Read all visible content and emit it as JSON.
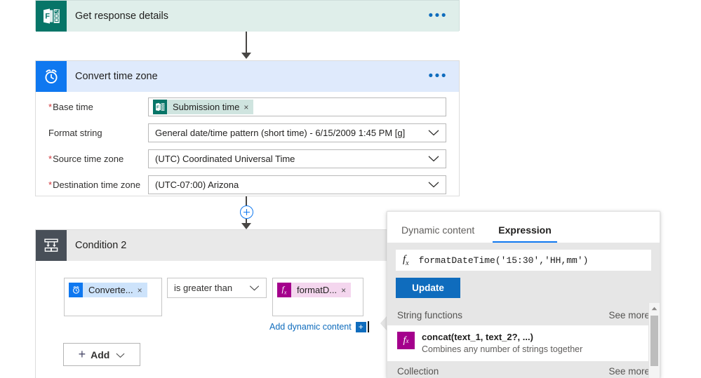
{
  "flow": {
    "forms_action": {
      "title": "Get response details",
      "icon": "microsoft-forms-icon",
      "menu": "•••",
      "header_bg": "#dfeeea",
      "icon_bg": "#077568"
    },
    "convert_time_zone": {
      "title": "Convert time zone",
      "icon": "alarm-clock-icon",
      "menu": "•••",
      "header_bg": "#dfeafc",
      "icon_bg": "#0f78f0",
      "fields": [
        {
          "label": "Base time",
          "required": true,
          "type": "token",
          "token": {
            "label": "Submission time",
            "icon": "microsoft-forms-icon",
            "remove": "×"
          }
        },
        {
          "label": "Format string",
          "required": false,
          "type": "dropdown",
          "value": "General date/time pattern (short time) - 6/15/2009 1:45 PM [g]"
        },
        {
          "label": "Source time zone",
          "required": true,
          "type": "dropdown",
          "value": "(UTC) Coordinated Universal Time"
        },
        {
          "label": "Destination time zone",
          "required": true,
          "type": "dropdown",
          "value": "(UTC-07:00) Arizona"
        }
      ]
    },
    "insert_node": {
      "label": "+",
      "name": "insert-step-button"
    },
    "condition": {
      "title": "Condition 2",
      "icon": "condition-branch-icon",
      "header_bg": "#e9e9e9",
      "icon_bg": "#484f58",
      "left_operand": {
        "label": "Converte...",
        "icon": "alarm-clock-icon",
        "remove": "×"
      },
      "operator": "is greater than",
      "right_operand": {
        "label": "formatD...",
        "icon": "function-fx-icon",
        "remove": "×"
      },
      "add_dynamic_content": "Add dynamic content",
      "add_dynamic_plus": "+",
      "add_button": "Add"
    }
  },
  "panel": {
    "tabs": [
      {
        "label": "Dynamic content",
        "active": false
      },
      {
        "label": "Expression",
        "active": true
      }
    ],
    "expression": {
      "fx_glyph": "f",
      "fx_sub": "x",
      "value": "formatDateTime('15:30','HH,mm')",
      "update_label": "Update"
    },
    "sections": [
      {
        "title": "String functions",
        "see_more": "See more",
        "items": [
          {
            "name": "concat(text_1, text_2?, ...)",
            "description": "Combines any number of strings together",
            "icon": "function-fx-icon"
          }
        ]
      },
      {
        "title": "Collection",
        "see_more": "See more",
        "items": []
      }
    ]
  }
}
